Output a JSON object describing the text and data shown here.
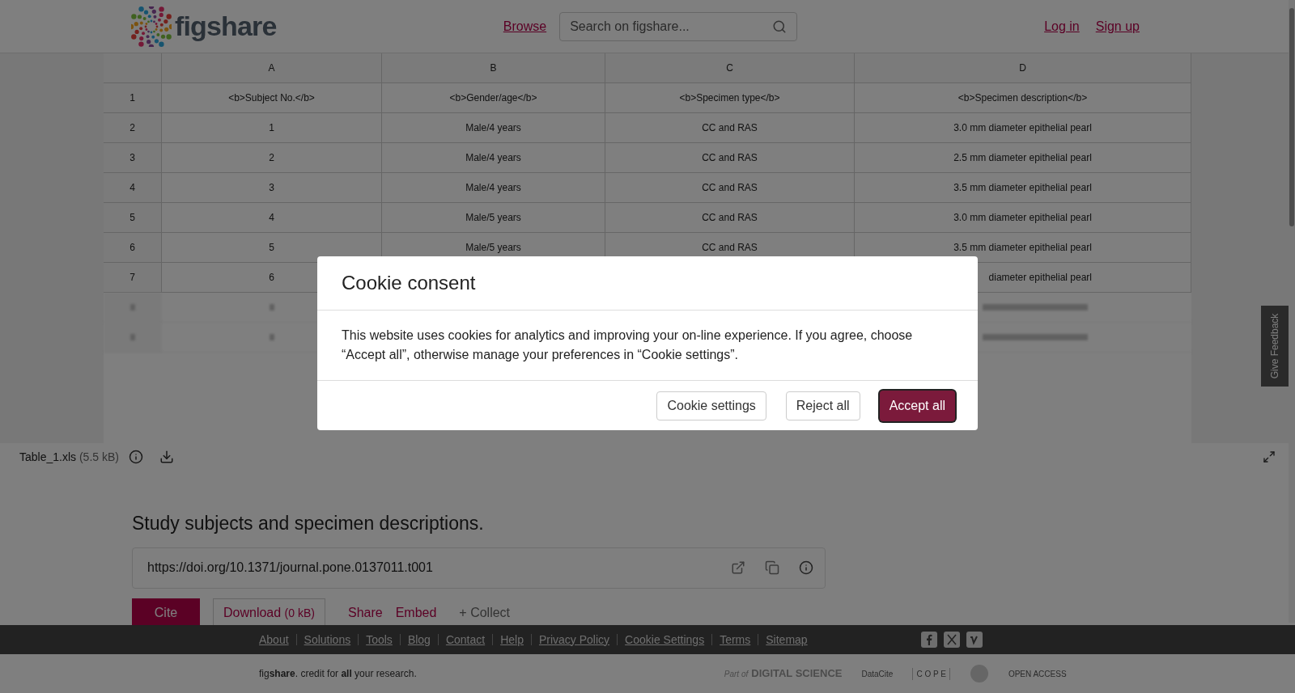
{
  "header": {
    "logo": "figshare",
    "nav": [
      "Browse"
    ],
    "search": {
      "placeholder": "Search on figshare..."
    },
    "auth": [
      "Log in",
      "Sign up"
    ]
  },
  "sheet": {
    "columns": [
      "A",
      "B",
      "C",
      "D"
    ],
    "rows": [
      {
        "n": "1",
        "cells": [
          "<b>Subject No.</b>",
          "<b>Gender/age</b>",
          "<b>Specimen type</b>",
          "<b>Specimen description</b>"
        ]
      },
      {
        "n": "2",
        "cells": [
          "1",
          "Male/4 years",
          "CC and RAS",
          "3.0 mm diameter epithelial pearl"
        ]
      },
      {
        "n": "3",
        "cells": [
          "2",
          "Male/4 years",
          "CC and RAS",
          "2.5 mm diameter epithelial pearl"
        ]
      },
      {
        "n": "4",
        "cells": [
          "3",
          "Male/4 years",
          "CC and RAS",
          "3.5 mm diameter epithelial pearl"
        ]
      },
      {
        "n": "5",
        "cells": [
          "4",
          "Male/5 years",
          "CC and RAS",
          "3.0 mm diameter epithelial pearl"
        ]
      },
      {
        "n": "6",
        "cells": [
          "5",
          "Male/5 years",
          "CC and RAS",
          "3.5 mm diameter epithelial pearl"
        ]
      },
      {
        "n": "7",
        "cells": [
          "6",
          "",
          "",
          "diameter epithelial pearl"
        ]
      }
    ]
  },
  "file": {
    "name": "Table_1.xls",
    "size": "(5.5 kB)"
  },
  "feedback": "Give Feedback",
  "item": {
    "title": "Study subjects and specimen descriptions.",
    "doi": "https://doi.org/10.1371/journal.pone.0137011.t001",
    "cite": "Cite",
    "download": "Download",
    "download_size": "(0 kB)",
    "links": [
      "Share",
      "Embed"
    ],
    "collect": "+ Collect"
  },
  "footer": {
    "links": [
      "About",
      "Solutions",
      "Tools",
      "Blog",
      "Contact",
      "Help",
      "Privacy Policy",
      "Cookie Settings",
      "Terms",
      "Sitemap"
    ],
    "tagline": "fig**share**. credit for **all** your research.",
    "partners": [
      "Part of",
      "DIGITAL SCIENCE",
      "DataCite",
      "C O P E",
      "OPEN ACCESS"
    ]
  },
  "modal": {
    "title": "Cookie consent",
    "body": "This website uses cookies for analytics and improving your on-line experience. If you agree, choose “Accept all”, otherwise manage your preferences in “Cookie settings”.",
    "buttons": [
      {
        "label": "Cookie settings",
        "primary": false
      },
      {
        "label": "Reject all",
        "primary": false
      },
      {
        "label": "Accept all",
        "primary": true
      }
    ]
  }
}
